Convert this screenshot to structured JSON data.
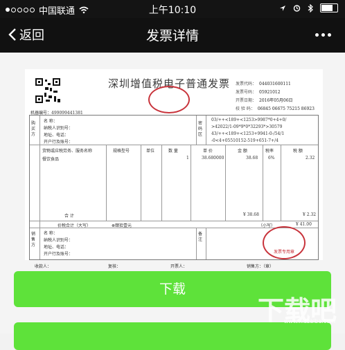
{
  "status": {
    "carrier": "中国联通",
    "time": "上午10:10",
    "battery_level": 0.8
  },
  "nav": {
    "back_label": "返回",
    "title": "发票详情"
  },
  "invoice": {
    "title": "深圳增值税电子普通发票",
    "code": "044031600111",
    "number": "05921012",
    "date": "2016年05月06日",
    "check_code": "06845 06675 75215 86923",
    "machine_no": "499099441381",
    "buyer_name_label": "名    称：",
    "buyer_taxid_label": "纳税人识别号：",
    "buyer_addr_label": "地址、电话：",
    "buyer_bank_label": "开户行及账号：",
    "cipher": [
      "03/++<189+<1253>9987*0+4+0/",
      ">42022/1-09*9*0*32293*>30579",
      "43/++<189+<1253+9941-0-/54/1",
      "-0<4+05510152-519+651-7+/4"
    ],
    "col_goods": "货物或应税劳务、服务名称",
    "col_spec": "规格型号",
    "col_unit": "单位",
    "col_qty": "数 量",
    "col_price": "单 价",
    "col_amount": "金 额",
    "col_rate": "税率",
    "col_tax": "税 额",
    "item_name": "餐饮食品",
    "item_qty": "1",
    "item_price": "38.680000",
    "item_amount": "38.68",
    "item_rate": "6%",
    "item_tax": "2.32",
    "subtotal_label": "合    计",
    "subtotal_amount": "¥ 38.68",
    "subtotal_tax": "¥ 2.32",
    "total_label": "价税合计（大写）",
    "total_words": "⊗肆拾壹元",
    "total_small": "（小写）",
    "total_number": "¥ 41.00",
    "seller_name_label": "名    称：",
    "seller_taxid_label": "纳税人识别号：",
    "seller_addr_label": "地址、电话：",
    "seller_bank_label": "开户行及账号：",
    "footer_payee": "收款人：",
    "footer_review": "复核：",
    "footer_issuer": "开票人：",
    "footer_seller": "销售方：（章）",
    "seal_text": "发票专用章",
    "labels": {
      "code": "发票代码：",
      "number": "发票号码：",
      "date": "开票日期：",
      "check": "校 验 码：",
      "machine": "机器编号："
    },
    "side_buyer": "购买方",
    "side_cipher": "密码区",
    "side_seller": "销售方",
    "side_remark": "备注"
  },
  "buttons": {
    "download": "下载"
  },
  "watermark": {
    "main": "下载吧",
    "sub": "www.xiazaiba.com"
  },
  "colors": {
    "accent_green": "#5ee23a",
    "seal_red": "#c8333b",
    "nav_bg": "#111111"
  }
}
